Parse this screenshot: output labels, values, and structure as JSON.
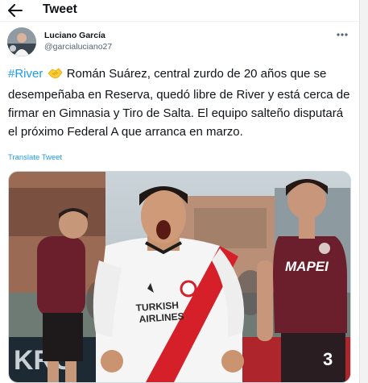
{
  "header": {
    "title": "Tweet",
    "back_icon": "arrow-left-icon"
  },
  "tweet": {
    "author_name": "Luciano García",
    "author_handle": "@garcialuciano27",
    "hashtag": "#River",
    "emoji_icon": "handshake-emoji-icon",
    "body": " Román Suárez, central zurdo de 20 años que se desempeñaba en Reserva, quedó libre de River y está cerca de firmar en Gimnasia y Tiro de Salta. El equipo salteño disputará el próximo Federal A que arranca en marzo.",
    "translate_label": "Translate Tweet",
    "more_icon": "more-options-icon"
  },
  "media": {
    "jersey_sponsor_line1": "TURKISH",
    "jersey_sponsor_line2": "AIRLINES",
    "opponent_sponsor": "MAPEI",
    "opponent_number": "3",
    "ad_board_text": "KRO"
  },
  "colors": {
    "accent": "#1d9bf0",
    "text": "#0f1419",
    "secondary": "#536471",
    "river_red": "#d5202a",
    "lanus_maroon": "#6b1f2c"
  }
}
